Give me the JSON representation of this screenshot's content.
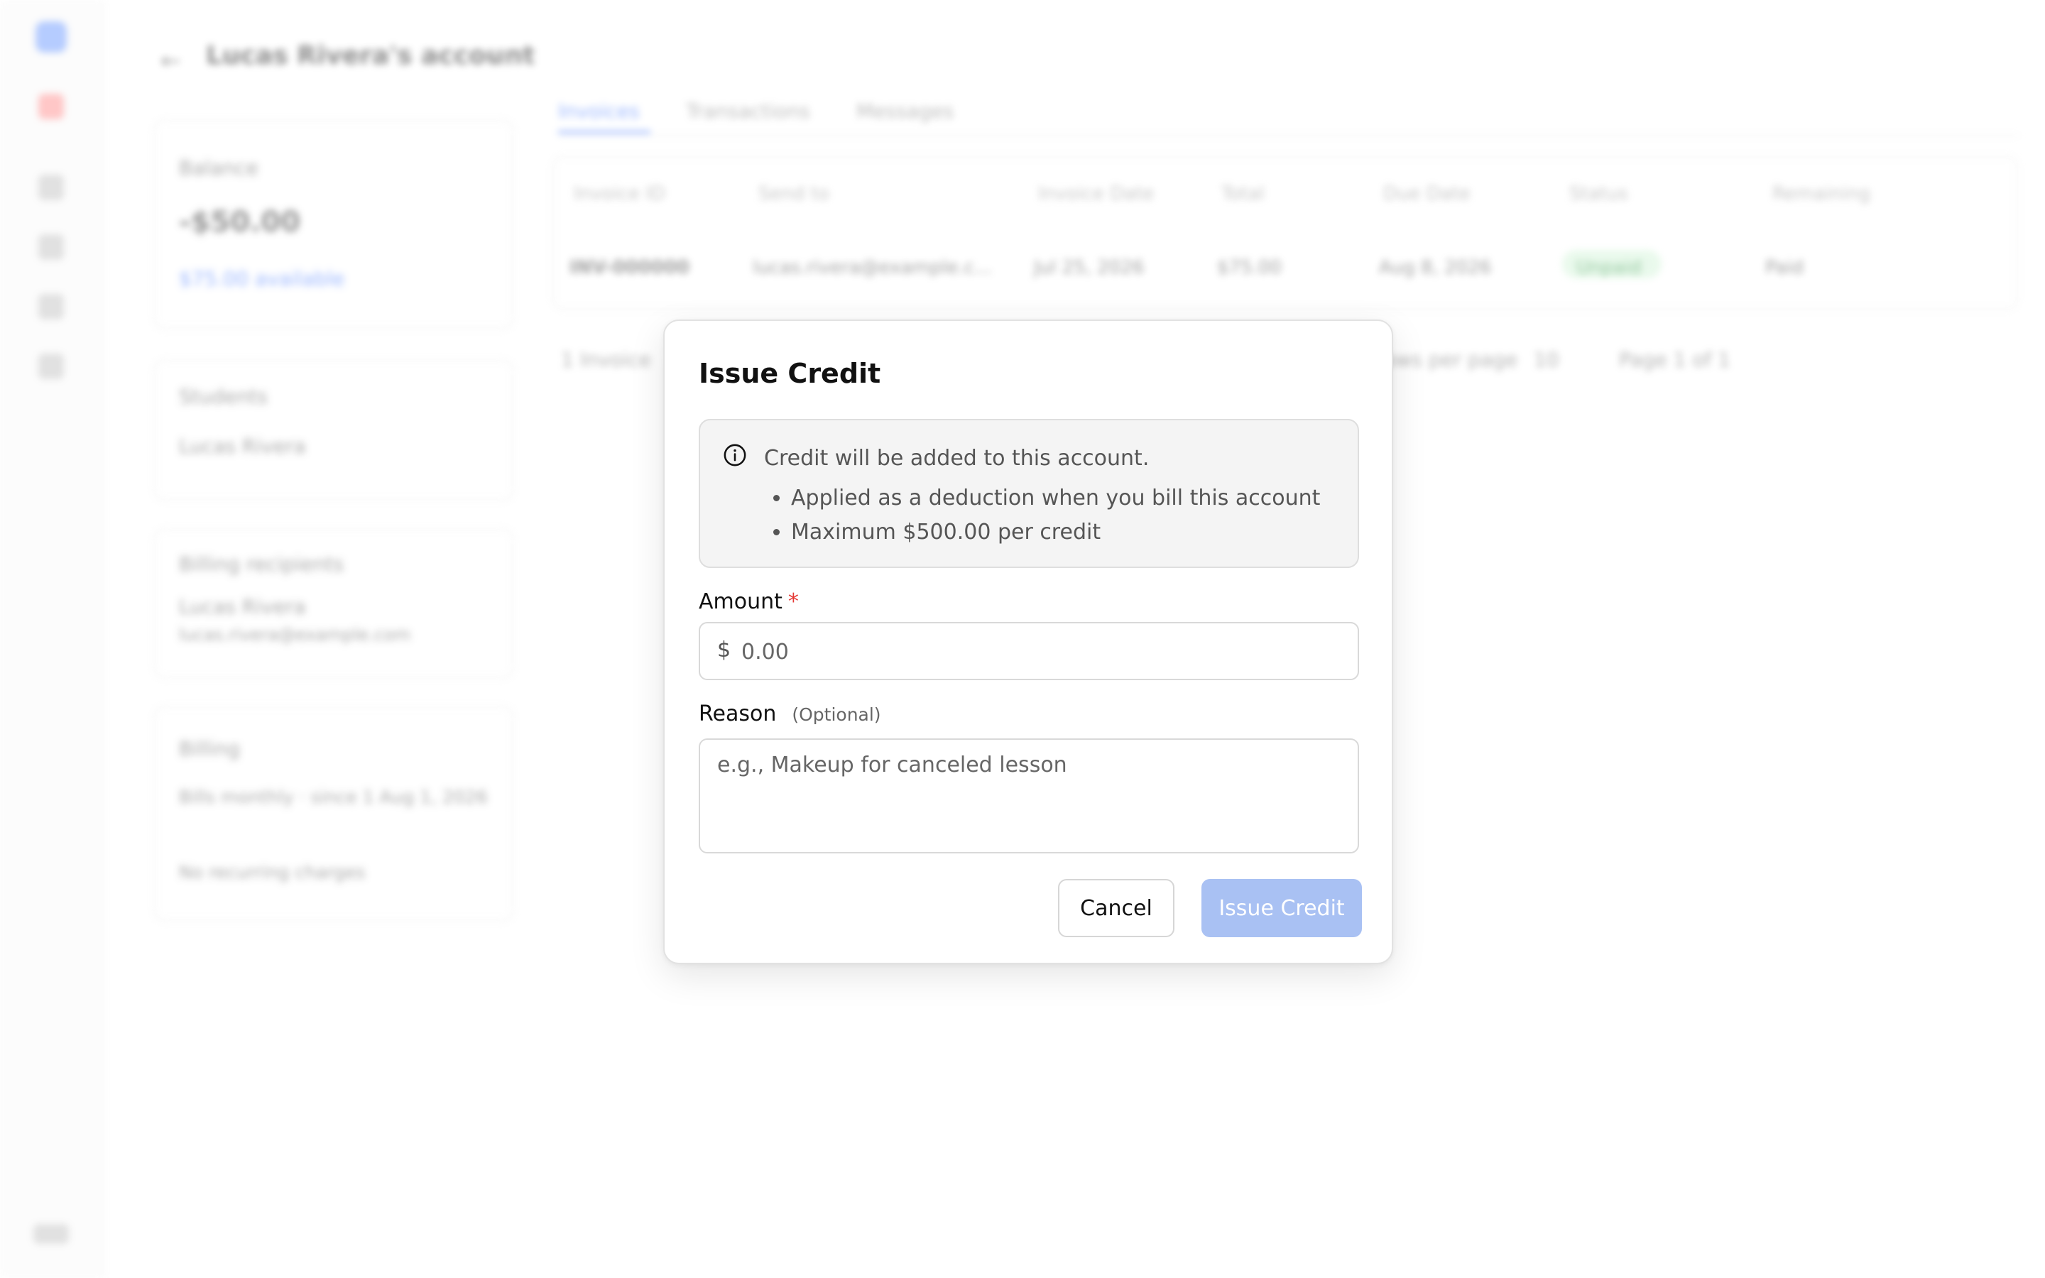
{
  "background": {
    "header": {
      "back": "←",
      "title": "Lucas Rivera's account",
      "more": "⋯"
    },
    "balance_card": {
      "title": "Balance",
      "amount": "-$50.00",
      "link": "$75.00 available"
    },
    "students_card": {
      "title": "Students",
      "item": "Lucas Rivera"
    },
    "billing_recipients_card": {
      "title": "Billing recipients",
      "name": "Lucas Rivera",
      "email": "lucas.rivera@example.com"
    },
    "billing_card": {
      "title": "Billing",
      "line1": "Bills monthly · since 1 Aug 1, 2026",
      "line2": "No recurring charges"
    },
    "tabs": [
      "Invoices",
      "Transactions",
      "Messages"
    ],
    "table": {
      "headers": [
        "Invoice ID",
        "Send to",
        "Invoice Date",
        "Total",
        "Due Date",
        "Status",
        "Remaining"
      ],
      "row": [
        "INV-000000",
        "lucas.rivera@example.c...",
        "Jul 25, 2026",
        "$75.00",
        "Aug 8, 2026",
        "Unpaid",
        "Paid"
      ]
    },
    "pager": {
      "count": "1 Invoice",
      "per_page_label": "Rows per page",
      "per_page": "10",
      "page": "Page 1 of 1"
    }
  },
  "modal": {
    "title": "Issue Credit",
    "info": {
      "icon": "info-icon",
      "heading": "Credit will be added to this account.",
      "bullets": [
        "Applied as a deduction when you bill this account",
        "Maximum $500.00 per credit"
      ]
    },
    "amount": {
      "label": "Amount",
      "required_mark": "*",
      "currency": "$",
      "placeholder": "0.00",
      "value": ""
    },
    "reason": {
      "label": "Reason",
      "optional": "(Optional)",
      "placeholder": "e.g., Makeup for canceled lesson",
      "value": ""
    },
    "buttons": {
      "cancel": "Cancel",
      "issue": "Issue Credit"
    }
  },
  "colors": {
    "accent": "#4a7dff",
    "issue_button_disabled": "#a9c1f3",
    "required": "#e53935"
  }
}
